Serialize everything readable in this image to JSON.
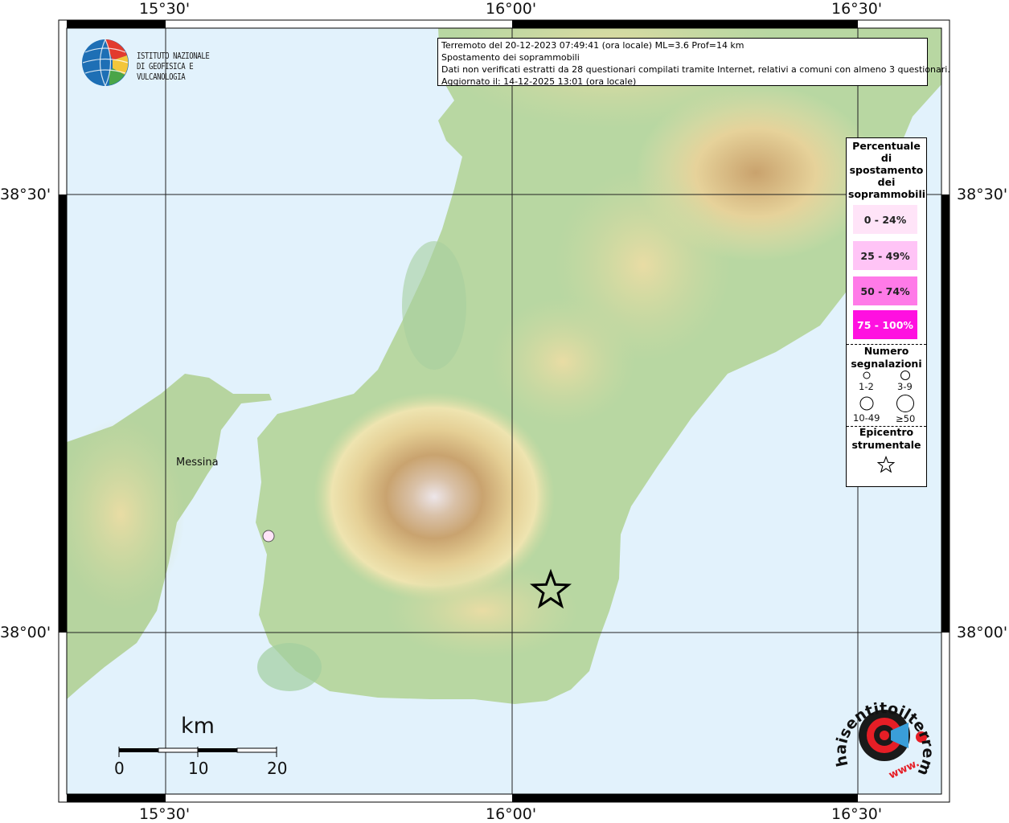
{
  "info": {
    "line1": "Terremoto del 20-12-2023 07:49:41 (ora locale) ML=3.6 Prof=14 km",
    "line2": "Spostamento dei soprammobili",
    "line3": "Dati non verificati estratti da 28 questionari compilati tramite Internet, relativi a comuni con almeno 3 questionari.",
    "line4": "Aggiornato il: 14-12-2025 13:01 (ora locale)"
  },
  "institute": {
    "line1": "ISTITUTO NAZIONALE",
    "line2": "DI GEOFISICA E VULCANOLOGIA"
  },
  "coords": {
    "top_left": "15°30'",
    "top_center": "16°00'",
    "top_right": "16°30'",
    "bottom_left": "15°30'",
    "bottom_center": "16°00'",
    "bottom_right": "16°30'",
    "left_upper": "38°30'",
    "left_lower": "38°00'",
    "right_upper": "38°30'",
    "right_lower": "38°00'"
  },
  "legend": {
    "title": "Percentuale di spostamento dei soprammobili",
    "bins": [
      {
        "label": "0 - 24%",
        "color": "#ffe4f8"
      },
      {
        "label": "25 - 49%",
        "color": "#ffc4f6"
      },
      {
        "label": "50 - 74%",
        "color": "#ff7ae8"
      },
      {
        "label": "75 - 100%",
        "color": "#ff10e0"
      }
    ],
    "count_title": "Numero segnalazioni",
    "counts": [
      "1-2",
      "3-9",
      "10-49",
      "≥50"
    ],
    "epicenter_title": "Epicentro strumentale"
  },
  "scale": {
    "unit": "km",
    "ticks": [
      "0",
      "10",
      "20"
    ]
  },
  "cities": [
    {
      "name": "Messina"
    }
  ],
  "observations": [
    {
      "color": "#ffe4f8"
    }
  ],
  "site_logo": {
    "text": "haisentitoilterremoto.it",
    "url_text": "www."
  },
  "colors": {
    "sea": "#e2f2fc",
    "land_low": "#a9d2a0",
    "land_mid": "#eee2ad",
    "land_high": "#c5a46d",
    "peak": "#ece6ea"
  }
}
